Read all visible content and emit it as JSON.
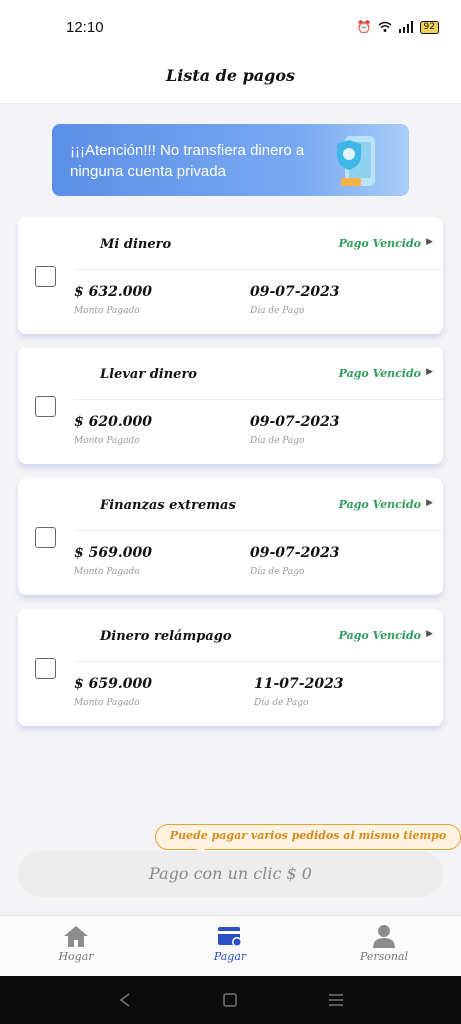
{
  "status_bar": {
    "time": "12:10",
    "battery": "92"
  },
  "header": {
    "title": "Lista de pagos"
  },
  "banner": {
    "text": "¡¡¡Atención!!! No transfiera dinero a ninguna cuenta privada"
  },
  "payments": [
    {
      "name": "Mi dinero",
      "status": "Pago Vencido",
      "amount": "$ 632.000",
      "amount_label": "Monto Pagado",
      "date": "09-07-2023",
      "date_label": "Día de Pago"
    },
    {
      "name": "Llevar dinero",
      "status": "Pago Vencido",
      "amount": "$ 620.000",
      "amount_label": "Monto Pagado",
      "date": "09-07-2023",
      "date_label": "Día de Pago"
    },
    {
      "name": "Finanzas extremas",
      "status": "Pago Vencido",
      "amount": "$ 569.000",
      "amount_label": "Monto Pagado",
      "date": "09-07-2023",
      "date_label": "Día de Pago"
    },
    {
      "name": "Dinero relámpago",
      "status": "Pago Vencido",
      "amount": "$ 659.000",
      "amount_label": "Monto Pagado",
      "date": "11-07-2023",
      "date_label": "Día de Pago"
    }
  ],
  "tooltip": {
    "text": "Puede pagar varios pedidos al mismo tiempo"
  },
  "pay_button": {
    "label": "Pago con un clic $ 0"
  },
  "tabs": [
    {
      "label": "Hogar",
      "icon": "home-icon",
      "active": false
    },
    {
      "label": "Pagar",
      "icon": "wallet-icon",
      "active": true
    },
    {
      "label": "Personal",
      "icon": "person-icon",
      "active": false
    }
  ],
  "colors": {
    "status_green": "#2e9e5a",
    "accent_blue": "#2b4fc4",
    "tooltip_orange": "#d98a1e"
  }
}
